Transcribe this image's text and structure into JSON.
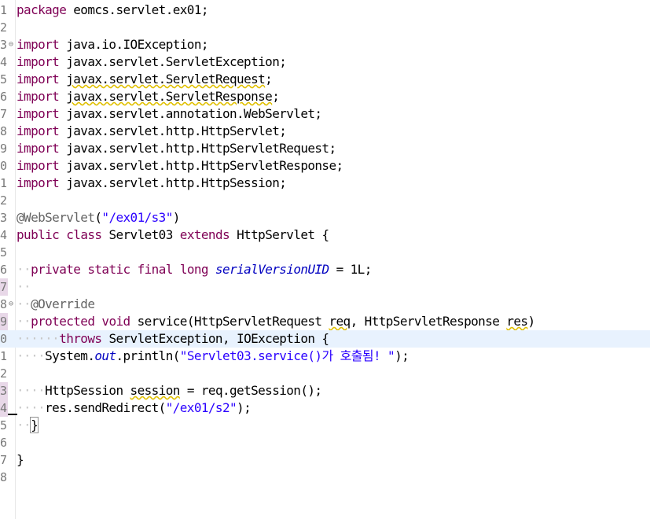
{
  "editor": {
    "file_language": "java",
    "colors": {
      "keyword": "#7f0055",
      "string": "#2a00ff",
      "annotation": "#646464",
      "field": "#0000c0",
      "current_line": "#e8f2fe",
      "line_number": "#787878"
    },
    "line_numbers": [
      "1",
      "2",
      "3",
      "4",
      "5",
      "6",
      "7",
      "8",
      "9",
      "0",
      "1",
      "2",
      "3",
      "4",
      "5",
      "6",
      "7",
      "8",
      "9",
      "0",
      "1",
      "2",
      "3",
      "4",
      "5",
      "6",
      "7",
      "8"
    ],
    "fold_markers": {
      "l3": "⊖",
      "l18": "⊖"
    },
    "code": {
      "l1": {
        "kw": "package",
        "rest": " eomcs.servlet.ex01;"
      },
      "l3": {
        "kw": "import",
        "rest": " java.io.IOException;"
      },
      "l4": {
        "kw": "import",
        "rest": " javax.servlet.ServletException;"
      },
      "l5": {
        "kw": "import",
        "pre": " ",
        "warn": "javax.servlet.ServletRequest",
        "rest": ";"
      },
      "l6": {
        "kw": "import",
        "pre": " ",
        "warn": "javax.servlet.ServletResponse",
        "rest": ";"
      },
      "l7": {
        "kw": "import",
        "rest": " javax.servlet.annotation.WebServlet;"
      },
      "l8": {
        "kw": "import",
        "rest": " javax.servlet.http.HttpServlet;"
      },
      "l9": {
        "kw": "import",
        "rest": " javax.servlet.http.HttpServletRequest;"
      },
      "l10": {
        "kw": "import",
        "rest": " javax.servlet.http.HttpServletResponse;"
      },
      "l11": {
        "kw": "import",
        "rest": " javax.servlet.http.HttpSession;"
      },
      "l13": {
        "ann": "@WebServlet",
        "open": "(",
        "str": "\"/ex01/s3\"",
        "close": ")"
      },
      "l14": {
        "kw1": "public",
        "kw2": "class",
        "name": " Servlet03 ",
        "kw3": "extends",
        "rest": " HttpServlet {"
      },
      "l16": {
        "kw1": "private",
        "kw2": "static",
        "kw3": "final",
        "kw4": "long",
        "field": "serialVersionUID",
        "rest": " = 1L;"
      },
      "l18": {
        "ann": "@Override"
      },
      "l19": {
        "kw1": "protected",
        "kw2": "void",
        "sig1": " service(HttpServletRequest ",
        "p1": "req",
        "sig2": ", HttpServletResponse ",
        "p2": "res",
        "sig3": ")"
      },
      "l20": {
        "kw": "throws",
        "rest": " ServletException, IOException {"
      },
      "l21": {
        "pre": "System.",
        "field": "out",
        "mid": ".println(",
        "str": "\"Servlet03.service()가 호출됨! \"",
        "rest": ");"
      },
      "l23": {
        "pre": "HttpSession ",
        "warn": "session",
        "rest": " = req.getSession();"
      },
      "l24": {
        "pre": "res.sendRedirect(",
        "str": "\"/ex01/s2\"",
        "rest": ");"
      },
      "l25": {
        "brace": "}"
      },
      "l27": {
        "brace": "}"
      }
    }
  }
}
